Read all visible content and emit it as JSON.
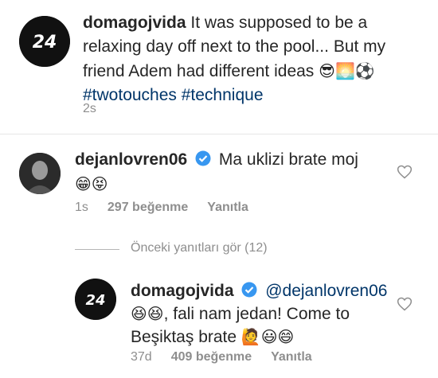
{
  "post": {
    "username": "domagojvida",
    "caption": "It was supposed to be a relaxing day off next to the pool... But my friend Adem had different ideas",
    "caption_emojis": "😎🌅⚽",
    "hashtags": "#twotouches #technique",
    "time": "2s"
  },
  "comment1": {
    "username": "dejanlovren06",
    "text": "Ma uklizi brate moj",
    "emojis": "😁😝",
    "time": "1s",
    "likes": "297 beğenme",
    "reply_label": "Yanıtla"
  },
  "view_replies": "Önceki yanıtları gör (12)",
  "reply1": {
    "username": "domagojvida",
    "mention": "@dejanlovren06",
    "lead_emojis": "😆😆",
    "text": ", fali nam jedan! Come to Beşiktaş brate",
    "emojis": "🙋😃😄",
    "time": "37d",
    "likes": "409 beğenme",
    "reply_label": "Yanıtla"
  },
  "colors": {
    "text": "#262626",
    "muted": "#8e8e8e",
    "link": "#003569",
    "verified": "#3897f0"
  }
}
